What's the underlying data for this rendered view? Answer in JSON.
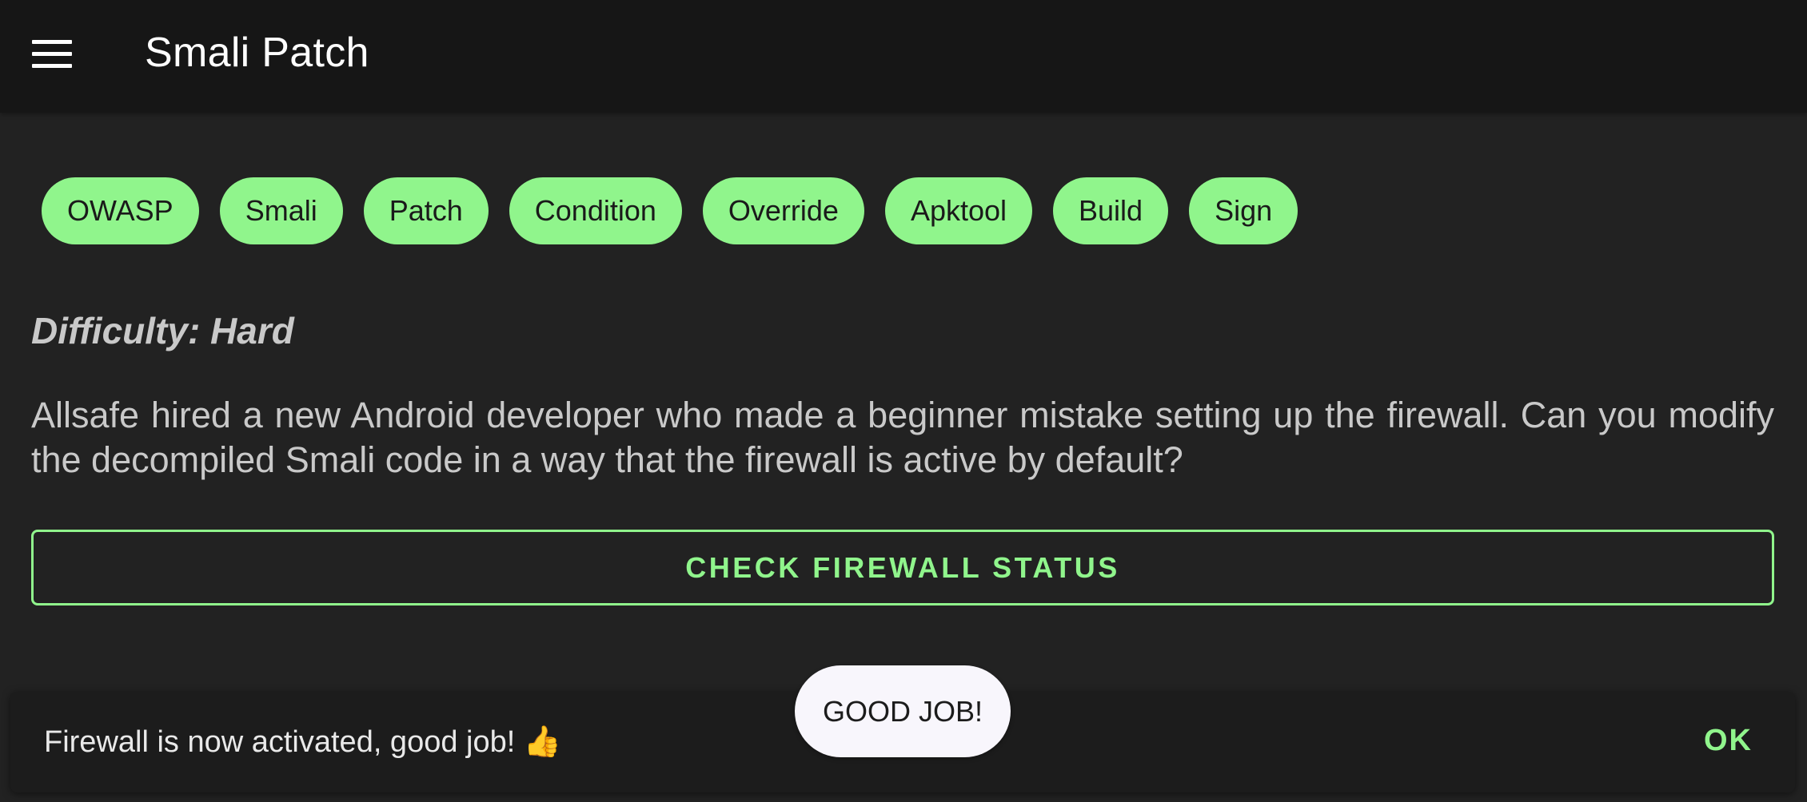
{
  "appbar": {
    "menu_icon": "hamburger-menu-icon",
    "title": "Smali Patch"
  },
  "chips": [
    {
      "label": "OWASP"
    },
    {
      "label": "Smali"
    },
    {
      "label": "Patch"
    },
    {
      "label": "Condition"
    },
    {
      "label": "Override"
    },
    {
      "label": "Apktool"
    },
    {
      "label": "Build"
    },
    {
      "label": "Sign"
    }
  ],
  "difficulty": "Difficulty: Hard",
  "description": "Allsafe hired a new Android developer who made a beginner mistake setting up the firewall. Can you modify the decompiled Smali code in a way that the firewall is active by default?",
  "check_button": "CHECK FIREWALL STATUS",
  "toast": "GOOD JOB!",
  "snackbar": {
    "message": "Firewall is now activated, good job!",
    "emoji": "👍",
    "action": "OK"
  },
  "colors": {
    "accent": "#90f58c",
    "background": "#222222",
    "appbar": "#161616",
    "text": "#c9c9c9"
  }
}
